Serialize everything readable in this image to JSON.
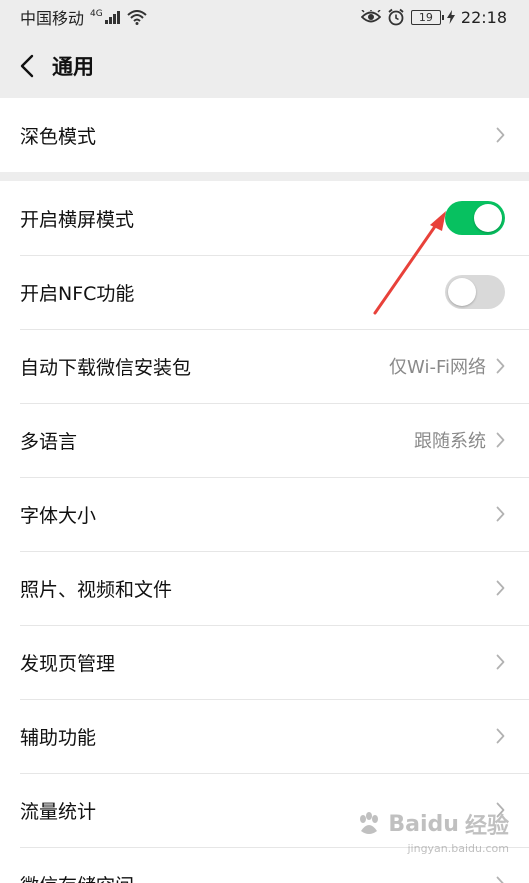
{
  "status_bar": {
    "carrier": "中国移动",
    "network": "4G",
    "battery": "19",
    "time": "22:18"
  },
  "header": {
    "title": "通用"
  },
  "group1": [
    {
      "label": "深色模式"
    }
  ],
  "group2": [
    {
      "label": "开启横屏模式",
      "toggle": true
    },
    {
      "label": "开启NFC功能",
      "toggle": false
    },
    {
      "label": "自动下载微信安装包",
      "value": "仅Wi-Fi网络"
    },
    {
      "label": "多语言",
      "value": "跟随系统"
    },
    {
      "label": "字体大小"
    },
    {
      "label": "照片、视频和文件"
    },
    {
      "label": "发现页管理"
    },
    {
      "label": "辅助功能"
    },
    {
      "label": "流量统计"
    },
    {
      "label": "微信存储空间"
    }
  ],
  "watermark": {
    "brand": "Baidu",
    "suffix": "经验",
    "url": "jingyan.baidu.com"
  },
  "colors": {
    "toggle_on": "#07c160",
    "toggle_off": "#d9d9d9",
    "annotation_arrow": "#e8413a"
  }
}
